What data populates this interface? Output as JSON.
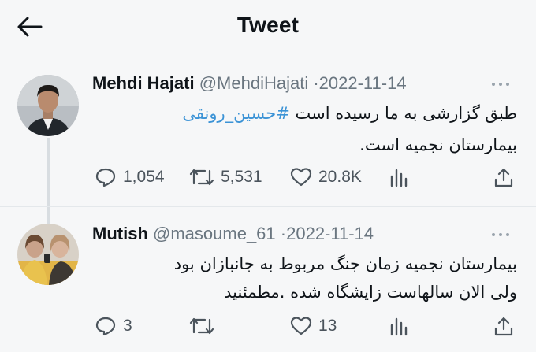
{
  "header": {
    "title": "Tweet"
  },
  "icons": {
    "back": "arrow-left-icon",
    "reply": "reply-icon",
    "retweet": "retweet-icon",
    "like": "heart-icon",
    "views": "analytics-icon",
    "share": "share-icon",
    "more": "more-dots-icon"
  },
  "colors": {
    "text": "#0f1419",
    "muted": "#6a7680",
    "hashtag": "#3b93d6",
    "background": "#f6f7f8"
  },
  "tweets": [
    {
      "display_name": "Mehdi Hajati",
      "handle": "@MehdiHajati",
      "separator": "·",
      "date": "2022-11-14",
      "text": {
        "line1_before": "طبق گزارشی به ما رسیده است ",
        "hashtag": "#حسین_رونقی",
        "line2": "بیمارستان نجمیه است."
      },
      "stats": {
        "replies": "1,054",
        "retweets": "5,531",
        "likes": "20.8K"
      }
    },
    {
      "display_name": "Mutish",
      "handle": "@masoume_61",
      "separator": "·",
      "date": "2022-11-14",
      "text": {
        "line1": "بیمارستان نجمیه زمان جنگ مربوط به جانبازان بود",
        "line2": "ولی الان سالهاست زایشگاه شده .مطمئنید"
      },
      "stats": {
        "replies": "3",
        "retweets": "",
        "likes": "13"
      }
    }
  ]
}
